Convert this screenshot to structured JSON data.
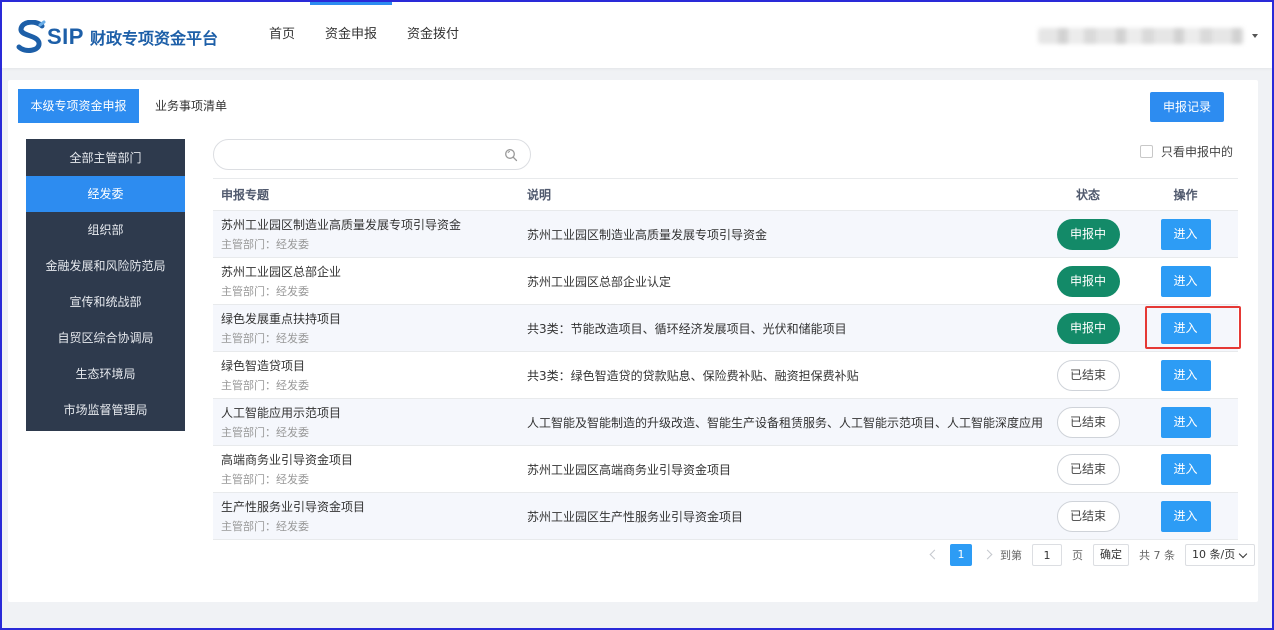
{
  "header": {
    "logo_text": "SIP",
    "platform_title": "财政专项资金平台",
    "nav": [
      {
        "label": "首页"
      },
      {
        "label": "资金申报"
      },
      {
        "label": "资金拨付"
      }
    ],
    "active_nav": "资金申报"
  },
  "tabs": [
    {
      "label": "本级专项资金申报"
    },
    {
      "label": "业务事项清单"
    }
  ],
  "records_button": "申报记录",
  "sidebar": {
    "items": [
      {
        "label": "全部主管部门"
      },
      {
        "label": "经发委"
      },
      {
        "label": "组织部"
      },
      {
        "label": "金融发展和风险防范局"
      },
      {
        "label": "宣传和统战部"
      },
      {
        "label": "自贸区综合协调局"
      },
      {
        "label": "生态环境局"
      },
      {
        "label": "市场监督管理局"
      }
    ],
    "active": "经发委"
  },
  "search": {
    "value": "",
    "placeholder": ""
  },
  "filter": {
    "label": "只看申报中的",
    "checked": false
  },
  "table": {
    "headers": {
      "topic": "申报专题",
      "desc": "说明",
      "status": "状态",
      "action": "操作"
    },
    "rows": [
      {
        "title": "苏州工业园区制造业高质量发展专项引导资金",
        "dept": "主管部门：经发委",
        "desc": "苏州工业园区制造业高质量发展专项引导资金",
        "status": "申报中",
        "action": "进入"
      },
      {
        "title": "苏州工业园区总部企业",
        "dept": "主管部门：经发委",
        "desc": "苏州工业园区总部企业认定",
        "status": "申报中",
        "action": "进入"
      },
      {
        "title": "绿色发展重点扶持项目",
        "dept": "主管部门：经发委",
        "desc": "共3类：节能改造项目、循环经济发展项目、光伏和储能项目",
        "status": "申报中",
        "action": "进入"
      },
      {
        "title": "绿色智造贷项目",
        "dept": "主管部门：经发委",
        "desc": "共3类：绿色智造贷的贷款贴息、保险费补贴、融资担保费补贴",
        "status": "已结束",
        "action": "进入"
      },
      {
        "title": "人工智能应用示范项目",
        "dept": "主管部门：经发委",
        "desc": "人工智能及智能制造的升级改造、智能生产设备租赁服务、人工智能示范项目、人工智能深度应用",
        "status": "已结束",
        "action": "进入"
      },
      {
        "title": "高端商务业引导资金项目",
        "dept": "主管部门：经发委",
        "desc": "苏州工业园区高端商务业引导资金项目",
        "status": "已结束",
        "action": "进入"
      },
      {
        "title": "生产性服务业引导资金项目",
        "dept": "主管部门：经发委",
        "desc": "苏州工业园区生产性服务业引导资金项目",
        "status": "已结束",
        "action": "进入"
      }
    ]
  },
  "pagination": {
    "current_page": "1",
    "goto_label": "到第",
    "goto_value": "1",
    "page_unit": "页",
    "confirm": "确定",
    "total": "共 7 条",
    "page_size": "10 条/页"
  },
  "colors": {
    "primary": "#2d8cf0",
    "sidebar_bg": "#2e3a4d",
    "status_active": "#138a68",
    "highlight": "#e53935",
    "logo": "#1d5fa8"
  }
}
